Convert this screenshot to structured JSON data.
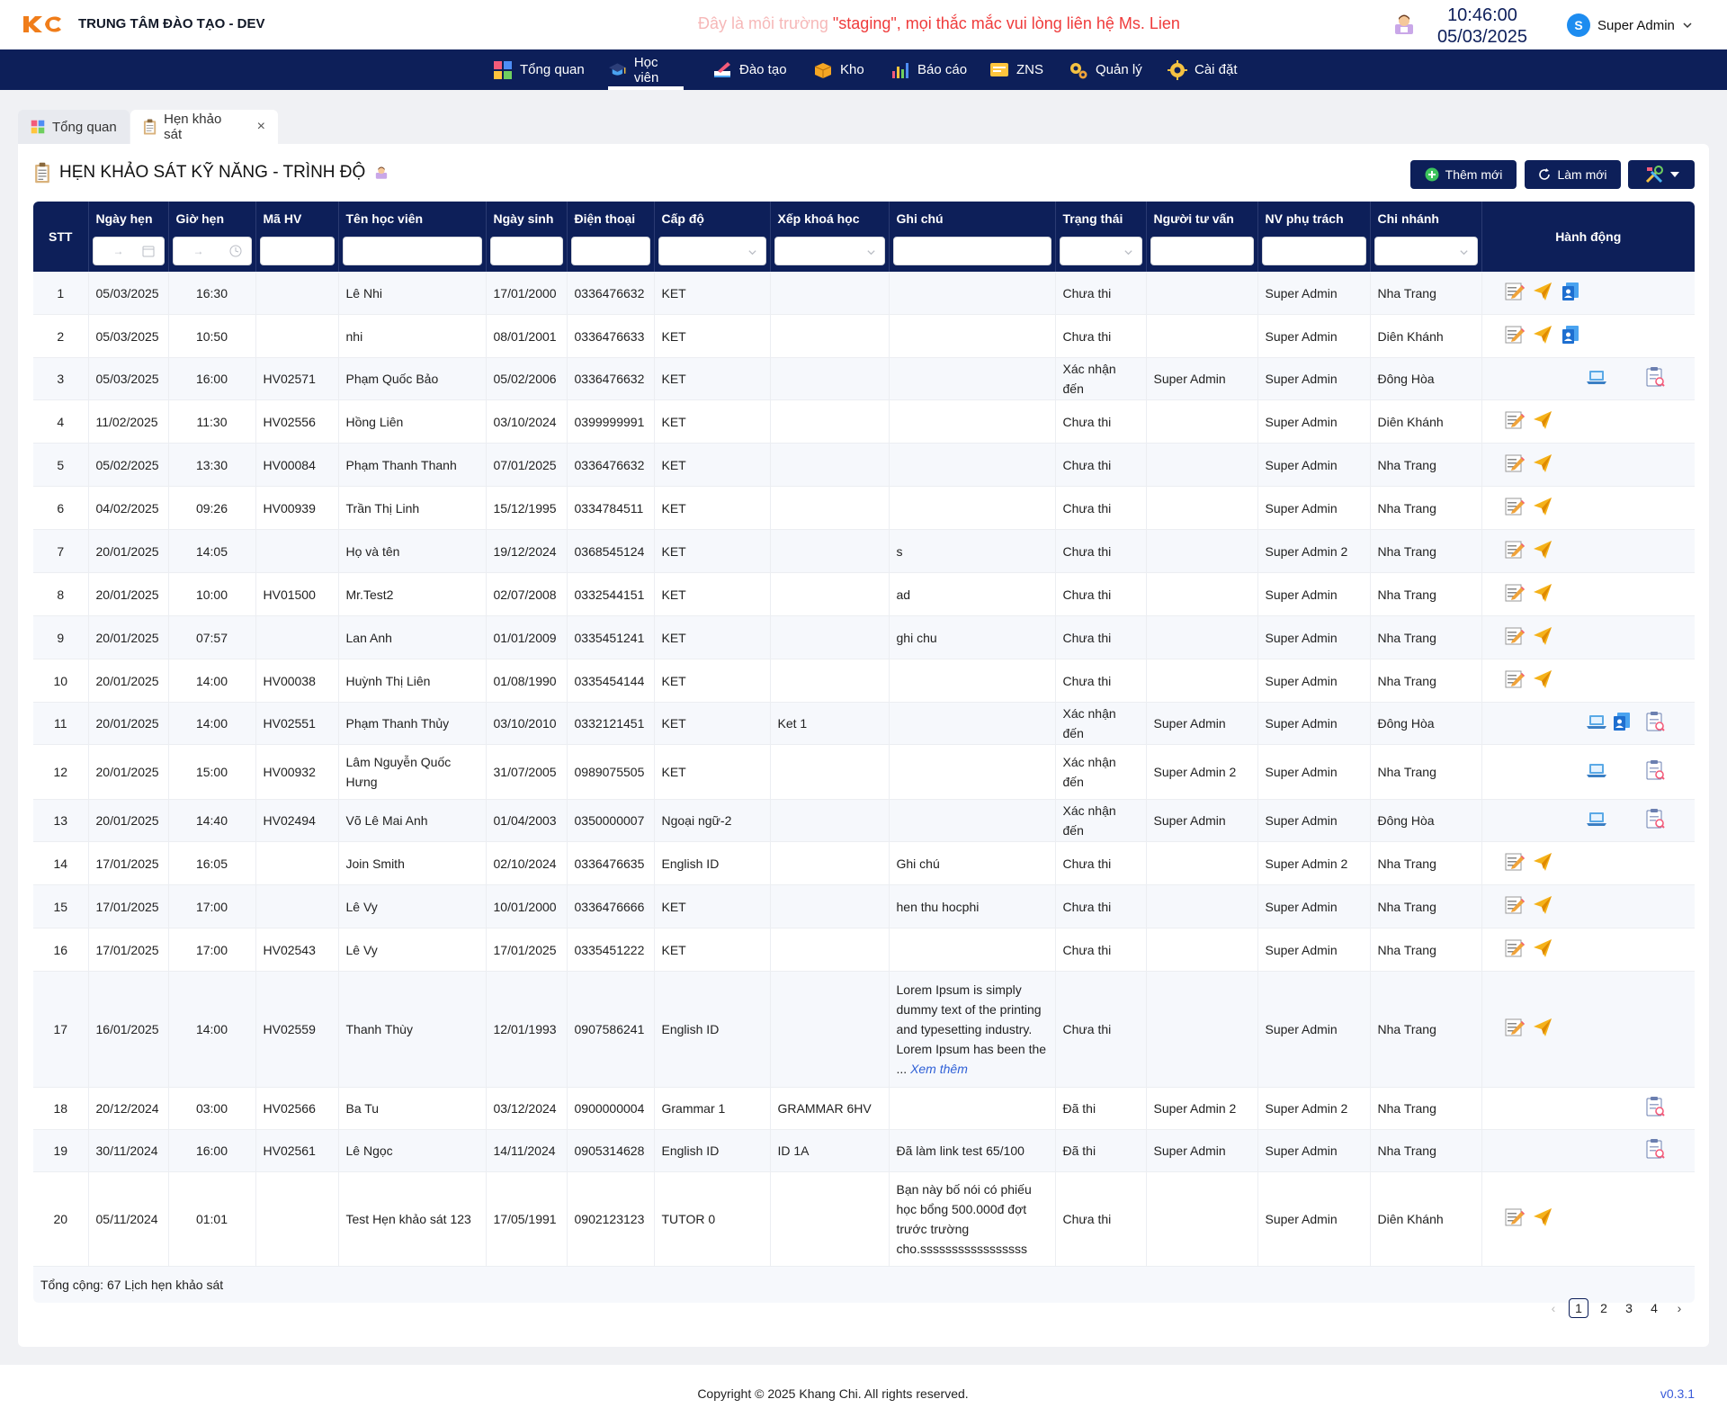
{
  "header": {
    "org_name": "TRUNG TÂM ĐÀO TẠO - DEV",
    "staging_fade": "Đây là môi trường ",
    "staging_text": "\"staging\", mọi thắc mắc vui lòng liên hệ Ms. Lien",
    "time": "10:46:00",
    "date": "05/03/2025",
    "user_initial": "S",
    "user_name": "Super Admin"
  },
  "nav": [
    {
      "label": "Tổng quan",
      "icon": "dashboard-icon"
    },
    {
      "label": "Học viên",
      "icon": "graduation-cap-icon",
      "active": true
    },
    {
      "label": "Đào tạo",
      "icon": "pencil-book-icon"
    },
    {
      "label": "Kho",
      "icon": "box-icon"
    },
    {
      "label": "Báo cáo",
      "icon": "bar-chart-icon"
    },
    {
      "label": "ZNS",
      "icon": "message-icon"
    },
    {
      "label": "Quản lý",
      "icon": "gears-icon"
    },
    {
      "label": "Cài đặt",
      "icon": "gear-icon"
    }
  ],
  "tabs": [
    {
      "label": "Tổng quan",
      "icon": "dashboard-icon"
    },
    {
      "label": "Hẹn khảo sát",
      "icon": "clipboard-icon",
      "closable": true
    }
  ],
  "page": {
    "title": "HẸN KHẢO SÁT KỸ NĂNG - TRÌNH ĐỘ",
    "add_label": "Thêm mới",
    "refresh_label": "Làm mới"
  },
  "table": {
    "columns": [
      "STT",
      "Ngày hẹn",
      "Giờ hẹn",
      "Mã HV",
      "Tên học viên",
      "Ngày sinh",
      "Điện thoại",
      "Cấp độ",
      "Xếp khoá học",
      "Ghi chú",
      "Trạng thái",
      "Người tư vấn",
      "NV phụ trách",
      "Chi nhánh",
      "Hành động"
    ],
    "date_filter_arrow": "→",
    "rows": [
      {
        "stt": "1",
        "date": "05/03/2025",
        "time": "16:30",
        "code": "",
        "name": "Lê Nhi",
        "dob": "17/01/2000",
        "phone": "0336476632",
        "level": "KET",
        "course": "",
        "note": "",
        "status": "Chưa thi",
        "consultant": "",
        "staff": "Super Admin",
        "branch": "Nha Trang",
        "actions": [
          "edit-icon",
          "send-icon",
          "assign-icon"
        ]
      },
      {
        "stt": "2",
        "date": "05/03/2025",
        "time": "10:50",
        "code": "",
        "name": "nhi",
        "dob": "08/01/2001",
        "phone": "0336476633",
        "level": "KET",
        "course": "",
        "note": "",
        "status": "Chưa thi",
        "consultant": "",
        "staff": "Super Admin",
        "branch": "Diên Khánh",
        "actions": [
          "edit-icon",
          "send-icon",
          "assign-icon"
        ]
      },
      {
        "stt": "3",
        "date": "05/03/2025",
        "time": "16:00",
        "code": "HV02571",
        "name": "Phạm Quốc Bảo",
        "dob": "05/02/2006",
        "phone": "0336476632",
        "level": "KET",
        "course": "",
        "note": "",
        "status": "Xác nhận đến",
        "consultant": "Super Admin",
        "staff": "Super Admin",
        "branch": "Đông Hòa",
        "actions": [
          "laptop-icon",
          "",
          "report-icon"
        ]
      },
      {
        "stt": "4",
        "date": "11/02/2025",
        "time": "11:30",
        "code": "HV02556",
        "name": "Hồng Liên",
        "dob": "03/10/2024",
        "phone": "0399999991",
        "level": "KET",
        "course": "",
        "note": "",
        "status": "Chưa thi",
        "consultant": "",
        "staff": "Super Admin",
        "branch": "Diên Khánh",
        "actions": [
          "edit-icon",
          "send-icon"
        ]
      },
      {
        "stt": "5",
        "date": "05/02/2025",
        "time": "13:30",
        "code": "HV00084",
        "name": "Phạm Thanh Thanh",
        "dob": "07/01/2025",
        "phone": "0336476632",
        "level": "KET",
        "course": "",
        "note": "",
        "status": "Chưa thi",
        "consultant": "",
        "staff": "Super Admin",
        "branch": "Nha Trang",
        "actions": [
          "edit-icon",
          "send-icon"
        ]
      },
      {
        "stt": "6",
        "date": "04/02/2025",
        "time": "09:26",
        "code": "HV00939",
        "name": "Trần Thị Linh",
        "dob": "15/12/1995",
        "phone": "0334784511",
        "level": "KET",
        "course": "",
        "note": "",
        "status": "Chưa thi",
        "consultant": "",
        "staff": "Super Admin",
        "branch": "Nha Trang",
        "actions": [
          "edit-icon",
          "send-icon"
        ]
      },
      {
        "stt": "7",
        "date": "20/01/2025",
        "time": "14:05",
        "code": "",
        "name": "Họ và tên",
        "dob": "19/12/2024",
        "phone": "0368545124",
        "level": "KET",
        "course": "",
        "note": "s",
        "status": "Chưa thi",
        "consultant": "",
        "staff": "Super Admin 2",
        "branch": "Nha Trang",
        "actions": [
          "edit-icon",
          "send-icon"
        ]
      },
      {
        "stt": "8",
        "date": "20/01/2025",
        "time": "10:00",
        "code": "HV01500",
        "name": "Mr.Test2",
        "dob": "02/07/2008",
        "phone": "0332544151",
        "level": "KET",
        "course": "",
        "note": "ad",
        "status": "Chưa thi",
        "consultant": "",
        "staff": "Super Admin",
        "branch": "Nha Trang",
        "actions": [
          "edit-icon",
          "send-icon"
        ]
      },
      {
        "stt": "9",
        "date": "20/01/2025",
        "time": "07:57",
        "code": "",
        "name": "Lan Anh",
        "dob": "01/01/2009",
        "phone": "0335451241",
        "level": "KET",
        "course": "",
        "note": "ghi chu",
        "status": "Chưa thi",
        "consultant": "",
        "staff": "Super Admin",
        "branch": "Nha Trang",
        "actions": [
          "edit-icon",
          "send-icon"
        ]
      },
      {
        "stt": "10",
        "date": "20/01/2025",
        "time": "14:00",
        "code": "HV00038",
        "name": "Huỳnh Thị Liên",
        "dob": "01/08/1990",
        "phone": "0335454144",
        "level": "KET",
        "course": "",
        "note": "",
        "status": "Chưa thi",
        "consultant": "",
        "staff": "Super Admin",
        "branch": "Nha Trang",
        "actions": [
          "edit-icon",
          "send-icon"
        ]
      },
      {
        "stt": "11",
        "date": "20/01/2025",
        "time": "14:00",
        "code": "HV02551",
        "name": "Phạm Thanh Thủy",
        "dob": "03/10/2010",
        "phone": "0332121451",
        "level": "KET",
        "course": "Ket 1",
        "note": "",
        "status": "Xác nhận đến",
        "consultant": "Super Admin",
        "staff": "Super Admin",
        "branch": "Đông Hòa",
        "actions": [
          "laptop-icon",
          "assign-icon",
          "report-icon"
        ]
      },
      {
        "stt": "12",
        "date": "20/01/2025",
        "time": "15:00",
        "code": "HV00932",
        "name": "Lâm Nguyễn Quốc Hưng",
        "dob": "31/07/2005",
        "phone": "0989075505",
        "level": "KET",
        "course": "",
        "note": "",
        "status": "Xác nhận đến",
        "consultant": "Super Admin 2",
        "staff": "Super Admin",
        "branch": "Nha Trang",
        "actions": [
          "laptop-icon",
          "",
          "report-icon"
        ]
      },
      {
        "stt": "13",
        "date": "20/01/2025",
        "time": "14:40",
        "code": "HV02494",
        "name": "Võ Lê Mai Anh",
        "dob": "01/04/2003",
        "phone": "0350000007",
        "level": "Ngoại ngữ-2",
        "course": "",
        "note": "",
        "status": "Xác nhận đến",
        "consultant": "Super Admin",
        "staff": "Super Admin",
        "branch": "Đông Hòa",
        "actions": [
          "laptop-icon",
          "",
          "report-icon"
        ]
      },
      {
        "stt": "14",
        "date": "17/01/2025",
        "time": "16:05",
        "code": "",
        "name": "Join Smith",
        "dob": "02/10/2024",
        "phone": "0336476635",
        "level": "English ID",
        "course": "",
        "note": "Ghi chú",
        "status": "Chưa thi",
        "consultant": "",
        "staff": "Super Admin 2",
        "branch": "Nha Trang",
        "actions": [
          "edit-icon",
          "send-icon"
        ]
      },
      {
        "stt": "15",
        "date": "17/01/2025",
        "time": "17:00",
        "code": "",
        "name": "Lê Vy",
        "dob": "10/01/2000",
        "phone": "0336476666",
        "level": "KET",
        "course": "",
        "note": "hen thu hocphi",
        "status": "Chưa thi",
        "consultant": "",
        "staff": "Super Admin",
        "branch": "Nha Trang",
        "actions": [
          "edit-icon",
          "send-icon"
        ]
      },
      {
        "stt": "16",
        "date": "17/01/2025",
        "time": "17:00",
        "code": "HV02543",
        "name": "Lê Vy",
        "dob": "17/01/2025",
        "phone": "0335451222",
        "level": "KET",
        "course": "",
        "note": "",
        "status": "Chưa thi",
        "consultant": "",
        "staff": "Super Admin",
        "branch": "Nha Trang",
        "actions": [
          "edit-icon",
          "send-icon"
        ]
      },
      {
        "stt": "17",
        "date": "16/01/2025",
        "time": "14:00",
        "code": "HV02559",
        "name": "Thanh Thùy",
        "dob": "12/01/1993",
        "phone": "0907586241",
        "level": "English ID",
        "course": "",
        "note": "Lorem Ipsum is simply dummy text of the printing and typesetting industry. Lorem Ipsum has been the ...",
        "note_more": "Xem thêm",
        "status": "Chưa thi",
        "consultant": "",
        "staff": "Super Admin",
        "branch": "Nha Trang",
        "actions": [
          "edit-icon",
          "send-icon"
        ]
      },
      {
        "stt": "18",
        "date": "20/12/2024",
        "time": "03:00",
        "code": "HV02566",
        "name": "Ba Tu",
        "dob": "03/12/2024",
        "phone": "0900000004",
        "level": "Grammar 1",
        "course": "GRAMMAR 6HV",
        "note": "",
        "status": "Đã thi",
        "consultant": "Super Admin 2",
        "staff": "Super Admin 2",
        "branch": "Nha Trang",
        "actions": [
          "",
          "",
          "report-icon"
        ]
      },
      {
        "stt": "19",
        "date": "30/11/2024",
        "time": "16:00",
        "code": "HV02561",
        "name": "Lê Ngọc",
        "dob": "14/11/2024",
        "phone": "0905314628",
        "level": "English ID",
        "course": "ID 1A",
        "note": "Đã làm link test 65/100",
        "status": "Đã thi",
        "consultant": "Super Admin",
        "staff": "Super Admin",
        "branch": "Nha Trang",
        "actions": [
          "",
          "",
          "report-icon"
        ]
      },
      {
        "stt": "20",
        "date": "05/11/2024",
        "time": "01:01",
        "code": "",
        "name": "Test Hẹn khảo sát 123",
        "dob": "17/05/1991",
        "phone": "0902123123",
        "level": "TUTOR 0",
        "course": "",
        "note": "Bạn này bố nói có phiếu học bổng 500.000đ đợt trước trường cho.sssssssssssssssss",
        "status": "Chưa thi",
        "consultant": "",
        "staff": "Super Admin",
        "branch": "Diên Khánh",
        "actions": [
          "edit-icon",
          "send-icon"
        ]
      }
    ],
    "total_label": "Tổng cộng: 67 Lịch hẹn khảo sát"
  },
  "pagination": {
    "pages": [
      "1",
      "2",
      "3",
      "4"
    ],
    "current": "1",
    "prev": "‹",
    "next": "›"
  },
  "footer": {
    "copyright": "Copyright © 2025 Khang Chi. All rights reserved.",
    "version": "v0.3.1"
  },
  "colors": {
    "navy": "#0d1f59",
    "staging_red": "#ef3b3b",
    "link_blue": "#2e5fd6"
  }
}
